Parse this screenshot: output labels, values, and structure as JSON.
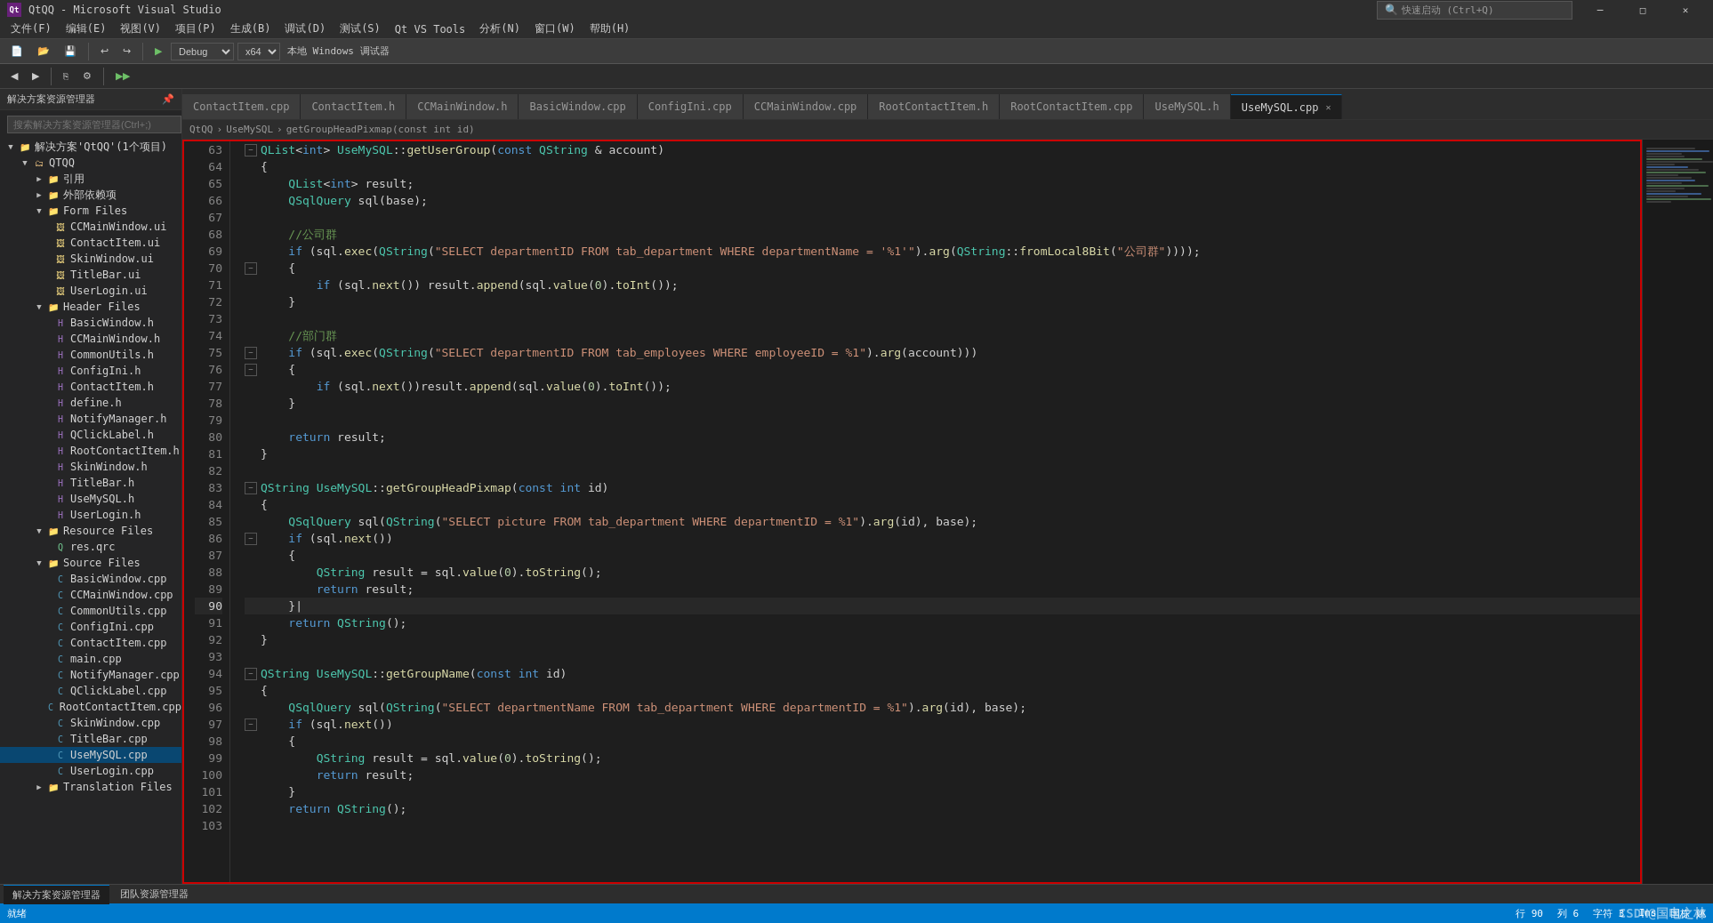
{
  "titleBar": {
    "icon": "Qt",
    "title": "QtQQ - Microsoft Visual Studio",
    "controls": [
      "minimize",
      "maximize",
      "close"
    ]
  },
  "menuBar": {
    "items": [
      "文件(F)",
      "编辑(E)",
      "视图(V)",
      "项目(P)",
      "生成(B)",
      "调试(D)",
      "测试(S)",
      "Qt VS Tools",
      "分析(N)",
      "窗口(W)",
      "帮助(H)"
    ]
  },
  "toolbar": {
    "debugMode": "Debug",
    "platform": "x64",
    "runLabel": "本地 Windows 调试器",
    "searchLabel": "快速启动 (Ctrl+Q)"
  },
  "tabs": [
    {
      "label": "ContactItem.cpp",
      "active": false
    },
    {
      "label": "ContactItem.h",
      "active": false
    },
    {
      "label": "CCMainWindow.h",
      "active": false
    },
    {
      "label": "BasicWindow.cpp",
      "active": false
    },
    {
      "label": "ConfigIni.cpp",
      "active": false
    },
    {
      "label": "CCMainWindow.cpp",
      "active": false
    },
    {
      "label": "RootContactItem.h",
      "active": false
    },
    {
      "label": "RootContactItem.cpp",
      "active": false
    },
    {
      "label": "UseMySQL.h",
      "active": false
    },
    {
      "label": "UseMySQL.cpp",
      "active": true,
      "modified": false
    }
  ],
  "breadcrumb": {
    "project": "QtQQ",
    "file": "UseMySQL",
    "function": "getGroupHeadPixmap(const int id)"
  },
  "sidebar": {
    "title": "解决方案资源管理器",
    "searchPlaceholder": "搜索解决方案资源管理器(Ctrl+;)",
    "tree": {
      "solution": "解决方案'QtQQ'(1个项目)",
      "project": "QTQQ",
      "nodes": [
        {
          "label": "引用",
          "type": "folder",
          "level": 2,
          "expanded": false
        },
        {
          "label": "外部依赖项",
          "type": "folder",
          "level": 2,
          "expanded": false
        },
        {
          "label": "Form Files",
          "type": "folder",
          "level": 2,
          "expanded": true
        },
        {
          "label": "CCMainWindow.ui",
          "type": "ui",
          "level": 3
        },
        {
          "label": "ContactItem.ui",
          "type": "ui",
          "level": 3
        },
        {
          "label": "SkinWindow.ui",
          "type": "ui",
          "level": 3
        },
        {
          "label": "TitleBar.ui",
          "type": "ui",
          "level": 3
        },
        {
          "label": "UserLogin.ui",
          "type": "ui",
          "level": 3
        },
        {
          "label": "Header Files",
          "type": "folder",
          "level": 2,
          "expanded": true
        },
        {
          "label": "BasicWindow.h",
          "type": "h",
          "level": 3
        },
        {
          "label": "CCMainWindow.h",
          "type": "h",
          "level": 3
        },
        {
          "label": "CommonUtils.h",
          "type": "h",
          "level": 3
        },
        {
          "label": "ConfigIni.h",
          "type": "h",
          "level": 3
        },
        {
          "label": "ContactItem.h",
          "type": "h",
          "level": 3
        },
        {
          "label": "define.h",
          "type": "h",
          "level": 3
        },
        {
          "label": "NotifyManager.h",
          "type": "h",
          "level": 3
        },
        {
          "label": "QClickLabel.h",
          "type": "h",
          "level": 3
        },
        {
          "label": "RootContactItem.h",
          "type": "h",
          "level": 3
        },
        {
          "label": "SkinWindow.h",
          "type": "h",
          "level": 3
        },
        {
          "label": "TitleBar.h",
          "type": "h",
          "level": 3
        },
        {
          "label": "UseMySQL.h",
          "type": "h",
          "level": 3
        },
        {
          "label": "UserLogin.h",
          "type": "h",
          "level": 3
        },
        {
          "label": "Resource Files",
          "type": "folder",
          "level": 2,
          "expanded": true
        },
        {
          "label": "res.qrc",
          "type": "qrc",
          "level": 3
        },
        {
          "label": "Source Files",
          "type": "folder",
          "level": 2,
          "expanded": true
        },
        {
          "label": "BasicWindow.cpp",
          "type": "cpp",
          "level": 3
        },
        {
          "label": "CCMainWindow.cpp",
          "type": "cpp",
          "level": 3
        },
        {
          "label": "CommonUtils.cpp",
          "type": "cpp",
          "level": 3
        },
        {
          "label": "ConfigIni.cpp",
          "type": "cpp",
          "level": 3
        },
        {
          "label": "ContactItem.cpp",
          "type": "cpp",
          "level": 3
        },
        {
          "label": "main.cpp",
          "type": "cpp",
          "level": 3
        },
        {
          "label": "NotifyManager.cpp",
          "type": "cpp",
          "level": 3
        },
        {
          "label": "QClickLabel.cpp",
          "type": "cpp",
          "level": 3
        },
        {
          "label": "RootContactItem.cpp",
          "type": "cpp",
          "level": 3
        },
        {
          "label": "SkinWindow.cpp",
          "type": "cpp",
          "level": 3
        },
        {
          "label": "TitleBar.cpp",
          "type": "cpp",
          "level": 3
        },
        {
          "label": "UseMySQL.cpp",
          "type": "cpp",
          "level": 3,
          "active": true
        },
        {
          "label": "UserLogin.cpp",
          "type": "cpp",
          "level": 3
        },
        {
          "label": "Translation Files",
          "type": "folder",
          "level": 2,
          "expanded": false
        }
      ]
    }
  },
  "code": {
    "lines": [
      {
        "num": 63,
        "fold": true,
        "indent": 0,
        "content": "QList<int> UseMySQL::getUserGroup(const QString & account)",
        "classes": [
          "type",
          "plain",
          "fn",
          "plain"
        ]
      },
      {
        "num": 64,
        "fold": false,
        "indent": 0,
        "content": "{"
      },
      {
        "num": 65,
        "fold": false,
        "indent": 1,
        "content": "    QList<int> result;"
      },
      {
        "num": 66,
        "fold": false,
        "indent": 1,
        "content": "    QSqlQuery sql(base);"
      },
      {
        "num": 67,
        "fold": false,
        "indent": 1,
        "content": ""
      },
      {
        "num": 68,
        "fold": false,
        "indent": 1,
        "content": "    //公司群",
        "comment": true
      },
      {
        "num": 69,
        "fold": false,
        "indent": 1,
        "content": "    if (sql.exec(QString(\"SELECT departmentID FROM tab_department WHERE departmentName = '%1'\").arg(QString::fromLocal8Bit(\"公司群\"))));"
      },
      {
        "num": 70,
        "fold": true,
        "indent": 1,
        "content": "    {"
      },
      {
        "num": 71,
        "fold": false,
        "indent": 2,
        "content": "        if (sql.next()) result.append(sql.value(0).toInt());"
      },
      {
        "num": 72,
        "fold": false,
        "indent": 1,
        "content": "    }"
      },
      {
        "num": 73,
        "fold": false,
        "indent": 1,
        "content": ""
      },
      {
        "num": 74,
        "fold": false,
        "indent": 1,
        "content": "    //部门群",
        "comment": true
      },
      {
        "num": 75,
        "fold": true,
        "indent": 1,
        "content": "    if (sql.exec(QString(\"SELECT departmentID FROM tab_employees WHERE employeeID = %1\").arg(account)))"
      },
      {
        "num": 76,
        "fold": true,
        "indent": 1,
        "content": "    {"
      },
      {
        "num": 77,
        "fold": false,
        "indent": 2,
        "content": "        if (sql.next())result.append(sql.value(0).toInt());"
      },
      {
        "num": 78,
        "fold": false,
        "indent": 1,
        "content": "    }"
      },
      {
        "num": 79,
        "fold": false,
        "indent": 1,
        "content": ""
      },
      {
        "num": 80,
        "fold": false,
        "indent": 1,
        "content": "    return result;"
      },
      {
        "num": 81,
        "fold": false,
        "indent": 0,
        "content": "}"
      },
      {
        "num": 82,
        "fold": false,
        "indent": 0,
        "content": ""
      },
      {
        "num": 83,
        "fold": true,
        "indent": 0,
        "content": "QString UseMySQL::getGroupHeadPixmap(const int id)"
      },
      {
        "num": 84,
        "fold": false,
        "indent": 0,
        "content": "{"
      },
      {
        "num": 85,
        "fold": false,
        "indent": 1,
        "content": "    QSqlQuery sql(QString(\"SELECT picture FROM tab_department WHERE departmentID = %1\").arg(id), base);"
      },
      {
        "num": 86,
        "fold": true,
        "indent": 1,
        "content": "    if (sql.next())"
      },
      {
        "num": 87,
        "fold": false,
        "indent": 1,
        "content": "    {"
      },
      {
        "num": 88,
        "fold": false,
        "indent": 2,
        "content": "        QString result = sql.value(0).toString();"
      },
      {
        "num": 89,
        "fold": false,
        "indent": 2,
        "content": "        return result;"
      },
      {
        "num": 90,
        "fold": false,
        "indent": 1,
        "content": "    }",
        "current": true
      },
      {
        "num": 91,
        "fold": false,
        "indent": 1,
        "content": "    return QString();"
      },
      {
        "num": 92,
        "fold": false,
        "indent": 0,
        "content": "}"
      },
      {
        "num": 93,
        "fold": false,
        "indent": 0,
        "content": ""
      },
      {
        "num": 94,
        "fold": true,
        "indent": 0,
        "content": "QString UseMySQL::getGroupName(const int id)"
      },
      {
        "num": 95,
        "fold": false,
        "indent": 0,
        "content": "{"
      },
      {
        "num": 96,
        "fold": false,
        "indent": 1,
        "content": "    QSqlQuery sql(QString(\"SELECT departmentName FROM tab_department WHERE departmentID = %1\").arg(id), base);"
      },
      {
        "num": 97,
        "fold": true,
        "indent": 1,
        "content": "    if (sql.next())"
      },
      {
        "num": 98,
        "fold": false,
        "indent": 1,
        "content": "    {"
      },
      {
        "num": 99,
        "fold": false,
        "indent": 2,
        "content": "        QString result = sql.value(0).toString();"
      },
      {
        "num": 100,
        "fold": false,
        "indent": 2,
        "content": "        return result;"
      },
      {
        "num": 101,
        "fold": false,
        "indent": 1,
        "content": "    }"
      },
      {
        "num": 102,
        "fold": false,
        "indent": 1,
        "content": "    return QString();"
      },
      {
        "num": 103,
        "fold": false,
        "indent": 0,
        "content": ""
      }
    ]
  },
  "statusBar": {
    "status": "就绪",
    "row": "行 90",
    "col": "列 6",
    "ch": "字符 3",
    "ins": "Ins",
    "user": "国栋 姚",
    "watermark": "CSDN@国电之林"
  },
  "bottomTabs": [
    {
      "label": "解决方案资源管理器",
      "active": true
    },
    {
      "label": "团队资源管理器",
      "active": false
    }
  ]
}
